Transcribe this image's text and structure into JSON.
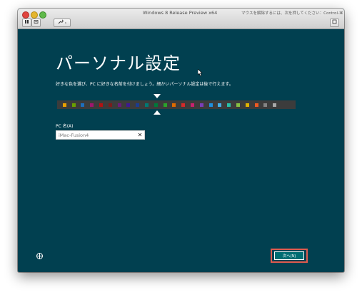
{
  "window": {
    "title": "Windows 8 Release Preview x64",
    "hint": "マウスを解除するには、次を押してください：Control-⌘",
    "toolbar": {
      "pause_icon": "pause-icon",
      "snapshot_icon": "snapshot-icon",
      "tools_icon": "wrench-icon"
    }
  },
  "setup": {
    "title": "パーソナル設定",
    "instructions": "好きな色を選び、PC に好きな名前を付けましょう。細かいパーソナル設定は後で行えます。",
    "pc_name_label": "PC 名(A)",
    "pc_name_value": "iMac-Fusion4",
    "clear_glyph": "✕",
    "next_button": "次へ(N)",
    "selected_color_index": 10,
    "colors": [
      "#e8a000",
      "#6aa100",
      "#1d6fbd",
      "#a0166e",
      "#b31212",
      "#7a1c1c",
      "#6b1b7b",
      "#3e1b90",
      "#1b3c90",
      "#007a74",
      "#007a3a",
      "#2aa52a",
      "#e06a00",
      "#d42a2a",
      "#c8226e",
      "#7a3fb8",
      "#1e90e0",
      "#44b0e8",
      "#27c0a8",
      "#86c043",
      "#e0b400",
      "#f05a22",
      "#848484",
      "#a8a8a8"
    ],
    "accessibility_icon": "ease-of-access-icon"
  }
}
